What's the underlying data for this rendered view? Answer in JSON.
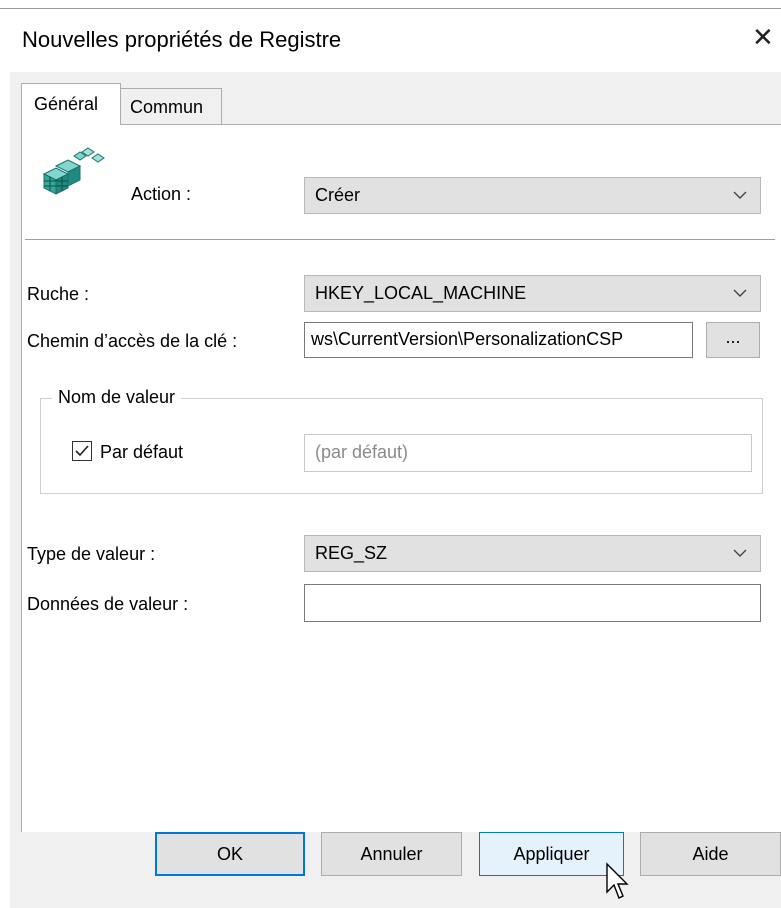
{
  "window": {
    "title": "Nouvelles propriétés de Registre",
    "close_glyph": "✕"
  },
  "tabs": [
    {
      "label": "Général",
      "active": true
    },
    {
      "label": "Commun",
      "active": false
    }
  ],
  "form": {
    "icon": "registry-icon",
    "action_label": "Action :",
    "action_value": "Créer",
    "hive_label": "Ruche :",
    "hive_value": "HKEY_LOCAL_MACHINE",
    "key_path_label": "Chemin d’accès de la clé :",
    "key_path_value": "ws\\CurrentVersion\\PersonalizationCSP",
    "browse_label": "...",
    "value_name_group": "Nom de valeur",
    "default_checkbox_label": "Par défaut",
    "default_checked": true,
    "value_name_placeholder": "(par défaut)",
    "value_type_label": "Type de valeur :",
    "value_type_value": "REG_SZ",
    "value_data_label": "Données de valeur :",
    "value_data_value": ""
  },
  "buttons": {
    "ok": "OK",
    "cancel": "Annuler",
    "apply": "Appliquer",
    "help": "Aide"
  },
  "colors": {
    "accent": "#0078d7",
    "combo_bg": "#e1e1e1",
    "dialog_bg": "#f0f0f0"
  }
}
